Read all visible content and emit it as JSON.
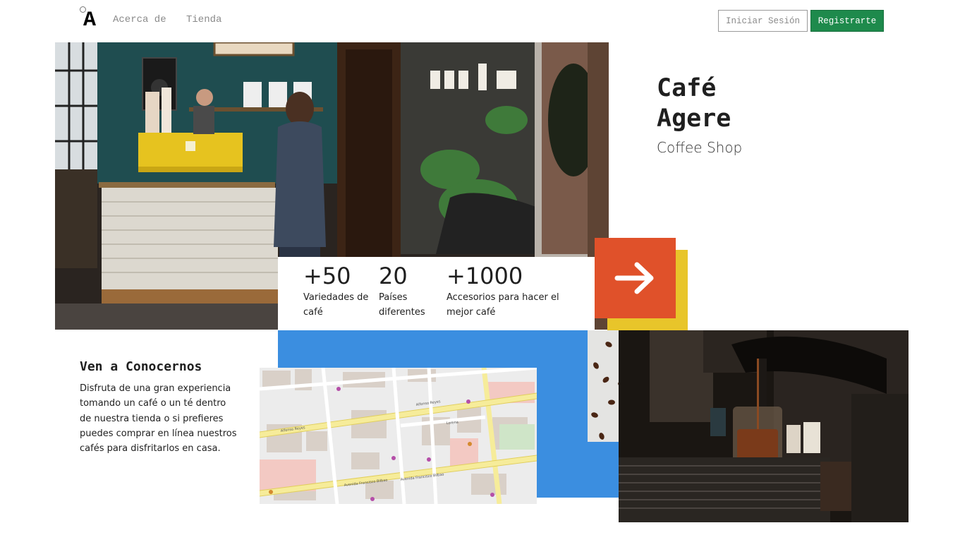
{
  "nav": {
    "logo_letter": "A",
    "links": [
      "Acerca de",
      "Tienda"
    ],
    "login_label": "Iniciar Sesión",
    "signup_label": "Registrarte",
    "signup_color": "#1e8a4c"
  },
  "hero": {
    "title_line1": "Café",
    "title_line2": "Agere",
    "subtitle": "Coffee Shop"
  },
  "stats": [
    {
      "number": "+50",
      "label": "Variedades de café"
    },
    {
      "number": "20",
      "label": "Países diferentes"
    },
    {
      "number": "+1000",
      "label": "Accesorios para hacer el mejor café"
    }
  ],
  "arrow": {
    "icon": "arrow-right-icon",
    "color": "#e0512a",
    "shadow_color": "#e8c52a"
  },
  "visit": {
    "title": "Ven a Conocernos",
    "text": "Disfruta de una gran experiencia tomando un café o un té dentro de nuestra tienda o si prefieres puedes comprar en línea nuestros cafés para disfritarlos en casa."
  },
  "map": {
    "streets": [
      "Alfonso Reyes",
      "Avenida Francisco Bilbao",
      "Lorena"
    ]
  },
  "colors": {
    "blue_block": "#3b8ee0"
  }
}
